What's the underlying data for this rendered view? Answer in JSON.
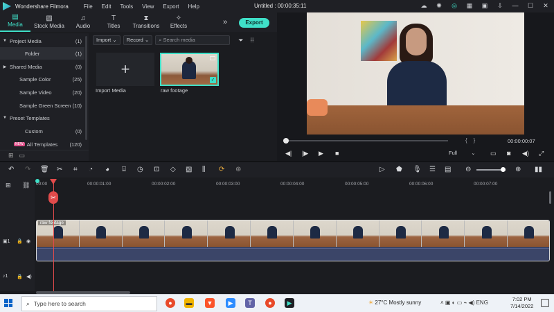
{
  "titlebar": {
    "app_name": "Wondershare Filmora",
    "menu": [
      "File",
      "Edit",
      "Tools",
      "View",
      "Export",
      "Help"
    ],
    "doc_title": "Untitled : 00:00:35:11",
    "icons": [
      "cloud-icon",
      "bulb-icon",
      "headset-icon",
      "grid-icon",
      "save-icon",
      "download-icon",
      "minimize-icon",
      "maximize-icon",
      "close-icon"
    ]
  },
  "media_tabs": [
    {
      "label": "Media",
      "icon": "media-icon",
      "active": true
    },
    {
      "label": "Stock Media",
      "icon": "stock-media-icon"
    },
    {
      "label": "Audio",
      "icon": "audio-icon"
    },
    {
      "label": "Titles",
      "icon": "titles-icon"
    },
    {
      "label": "Transitions",
      "icon": "transitions-icon"
    },
    {
      "label": "Effects",
      "icon": "effects-icon"
    }
  ],
  "export_label": "Export",
  "sidebar": {
    "items": [
      {
        "label": "Project Media",
        "count": "(1)",
        "expanded": true
      },
      {
        "label": "Folder",
        "count": "(1)",
        "selected": true
      },
      {
        "label": "Shared Media",
        "count": "(0)"
      },
      {
        "label": "Sample Color",
        "count": "(25)"
      },
      {
        "label": "Sample Video",
        "count": "(20)"
      },
      {
        "label": "Sample Green Screen",
        "count": "(10)"
      },
      {
        "label": "Preset Templates",
        "count": ""
      },
      {
        "label": "Custom",
        "count": "(0)"
      },
      {
        "label": "All Templates",
        "count": "(120)",
        "badge": "NEW"
      }
    ]
  },
  "media_toolbar": {
    "import_dd": "Import",
    "record_dd": "Record",
    "search_placeholder": "Search media"
  },
  "media_items": {
    "import_label": "Import Media",
    "clip_label": "raw footage"
  },
  "preview": {
    "timecode": "00:00:00:07",
    "quality": "Full",
    "progress": 0.0
  },
  "timeline": {
    "ticks": [
      "00:00",
      "00:00:01:00",
      "00:00:02:00",
      "00:00:03:00",
      "00:00:04:00",
      "00:00:05:00",
      "00:00:06:00",
      "00:00:07:00"
    ],
    "clip_label": "raw footage",
    "track_labels": [
      "1",
      "1"
    ]
  },
  "taskbar": {
    "search_placeholder": "Type here to search",
    "weather": "27°C  Mostly sunny",
    "language": "ENG",
    "time": "7:02 PM",
    "date": "7/14/2022"
  }
}
